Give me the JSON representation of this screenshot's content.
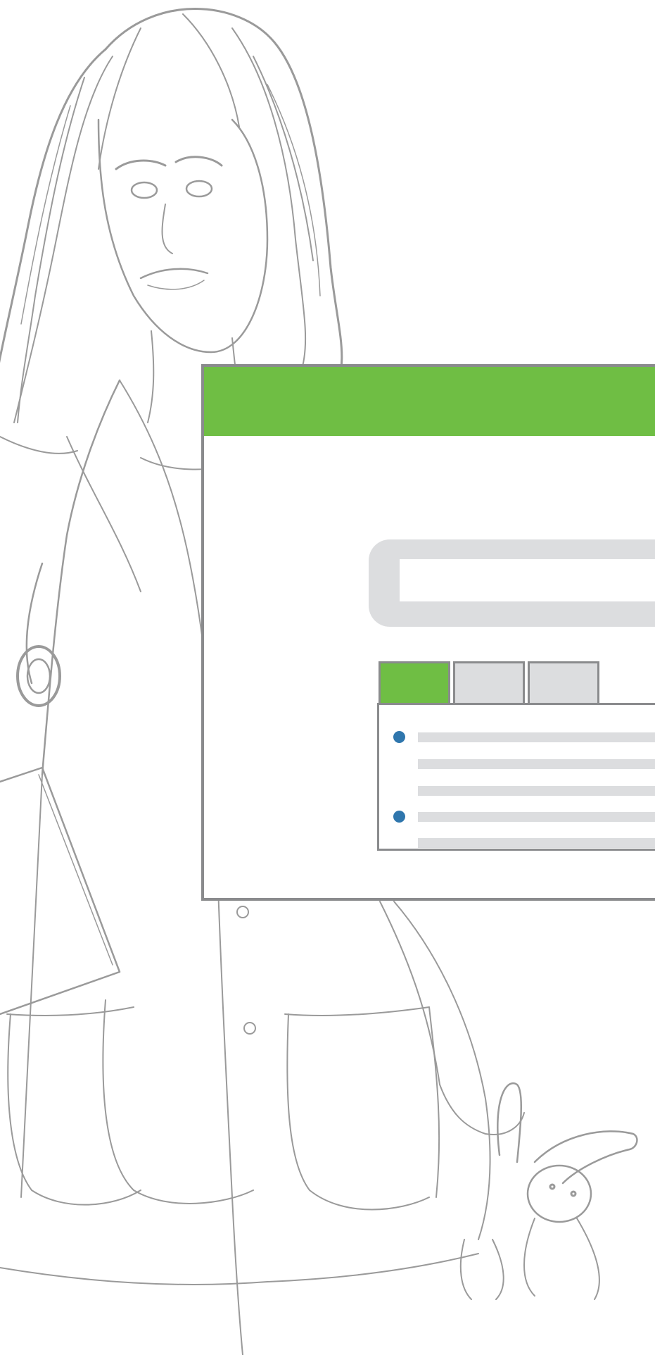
{
  "colors": {
    "header": "#6fbe44",
    "tab_active": "#6fbe44",
    "tab_inactive": "#dcdddf",
    "search_frame": "#dcdddf",
    "text_placeholder_lines": "#dcdddf",
    "bullet": "#2f76ad",
    "border": "#8a8b8d",
    "sketch": "#9a9a9a"
  },
  "illustration": {
    "subject": "pencil-sketch-doctor",
    "props": [
      "stethoscope-icon",
      "clipboard-icon",
      "toy-bunny-icon"
    ]
  },
  "browser": {
    "search": {
      "value": "",
      "placeholder": ""
    },
    "tabs": [
      {
        "label": "",
        "active": true
      },
      {
        "label": "",
        "active": false
      },
      {
        "label": "",
        "active": false
      }
    ],
    "list": [
      {
        "bullet": true,
        "text": ""
      },
      {
        "bullet": false,
        "text": ""
      },
      {
        "bullet": false,
        "text": ""
      },
      {
        "bullet": true,
        "text": ""
      },
      {
        "bullet": false,
        "text": ""
      }
    ]
  }
}
